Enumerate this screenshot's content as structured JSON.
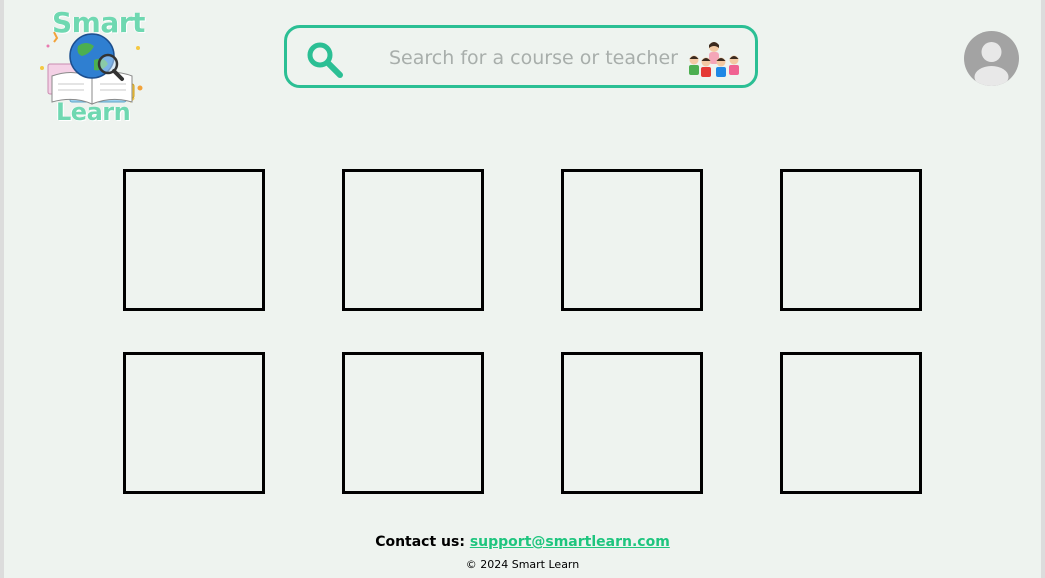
{
  "header": {
    "logo": {
      "word_top": "Smart",
      "word_bottom": "Learn"
    },
    "search": {
      "placeholder": "Search for a course or teacher",
      "value": "",
      "icon": "search-icon",
      "decoration_icon": "teacher-with-students-icon"
    },
    "avatar": {
      "icon": "user-avatar-icon"
    }
  },
  "course_grid": {
    "rows": 2,
    "columns": 4,
    "cards": [
      {
        "label": ""
      },
      {
        "label": ""
      },
      {
        "label": ""
      },
      {
        "label": ""
      },
      {
        "label": ""
      },
      {
        "label": ""
      },
      {
        "label": ""
      },
      {
        "label": ""
      }
    ]
  },
  "footer": {
    "contact_label": "Contact us:",
    "contact_email": "support@smartlearn.com",
    "copyright": "© 2024 Smart Learn"
  },
  "colors": {
    "background": "#eef3ef",
    "accent": "#2bbf94",
    "link": "#1ec57e",
    "logo_text": "#6fd8b1",
    "avatar": "#a3a3a3",
    "card_border": "#000000"
  }
}
